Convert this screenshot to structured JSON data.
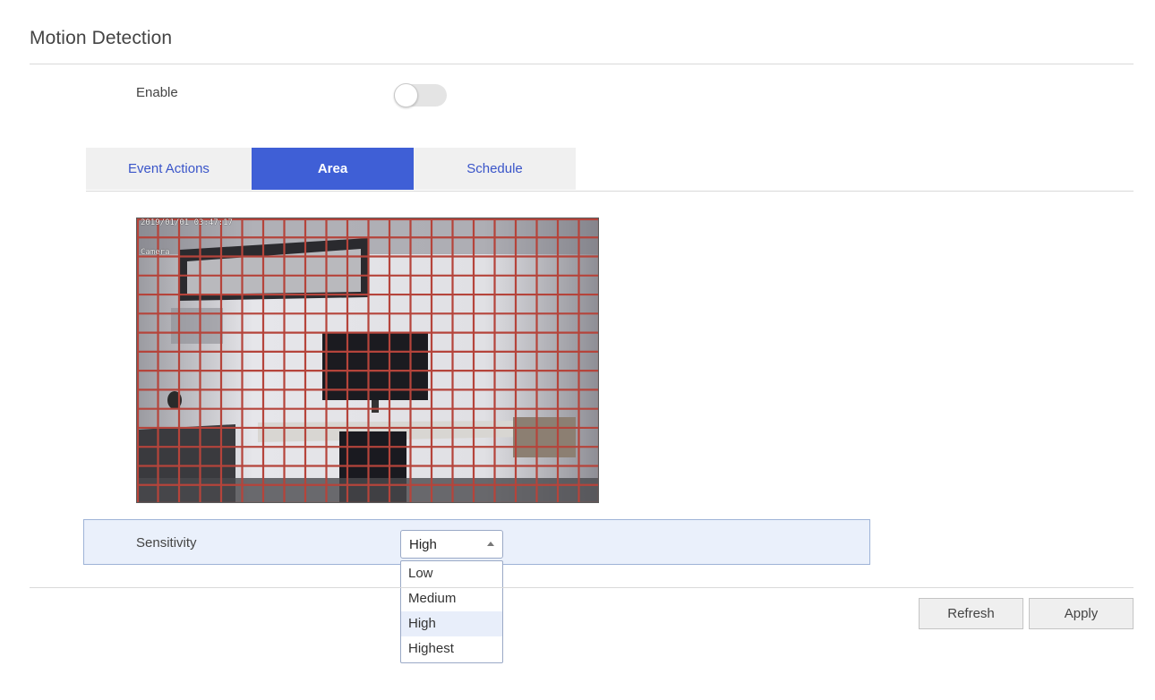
{
  "page": {
    "title": "Motion Detection"
  },
  "enable": {
    "label": "Enable",
    "state": "off"
  },
  "tabs": [
    {
      "label": "Event Actions",
      "active": false
    },
    {
      "label": "Area",
      "active": true
    },
    {
      "label": "Schedule",
      "active": false
    }
  ],
  "camera": {
    "timestamp": "2019/01/01 03:47:17",
    "caption": "Camera",
    "grid_columns": 22,
    "grid_rows": 15,
    "grid_color": "#b5443b"
  },
  "sensitivity": {
    "label": "Sensitivity",
    "selected": "High",
    "options": [
      "Low",
      "Medium",
      "High",
      "Highest"
    ]
  },
  "buttons": {
    "refresh": "Refresh",
    "apply": "Apply"
  },
  "colors": {
    "accent": "#3f5fd6",
    "tab_text": "#3a55c9",
    "row_highlight": "#eaf0fb"
  }
}
